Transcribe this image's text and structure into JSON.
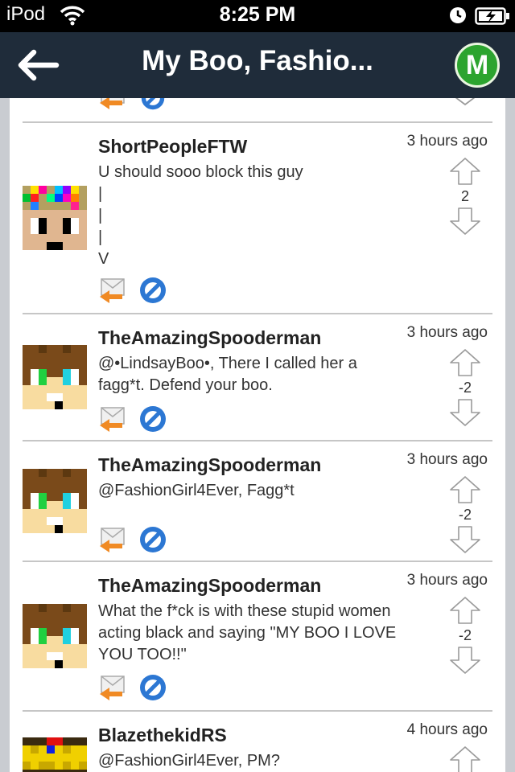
{
  "status_bar": {
    "carrier": "iPod",
    "time": "8:25 PM"
  },
  "nav": {
    "title": "My Boo, Fashio...",
    "logo_letter": "M"
  },
  "posts": [
    {
      "username": "ShortPeopleFTW",
      "time": "3 hours ago",
      "body": "U should sooo block this guy\n|\n|\n|\nV",
      "votes": "2"
    },
    {
      "username": "TheAmazingSpooderman",
      "time": "3 hours ago",
      "body": "@•LindsayBoo•, There I called her a fagg*t. Defend your boo.",
      "votes": "-2"
    },
    {
      "username": "TheAmazingSpooderman",
      "time": "3 hours ago",
      "body": "@FashionGirl4Ever, Fagg*t",
      "votes": "-2"
    },
    {
      "username": "TheAmazingSpooderman",
      "time": "3 hours ago",
      "body": "What the f*ck is with these stupid women acting black and saying \"MY BOO I LOVE YOU TOO!!\"",
      "votes": "-2"
    },
    {
      "username": "BlazethekidRS",
      "time": "4 hours ago",
      "body": "@FashionGirl4Ever, PM?",
      "votes": ""
    }
  ],
  "colors": {
    "nav_bg": "#1f2c3a",
    "logo_green": "#2ca42f",
    "block_blue": "#2c77d3",
    "reply_orange": "#f08a24"
  }
}
